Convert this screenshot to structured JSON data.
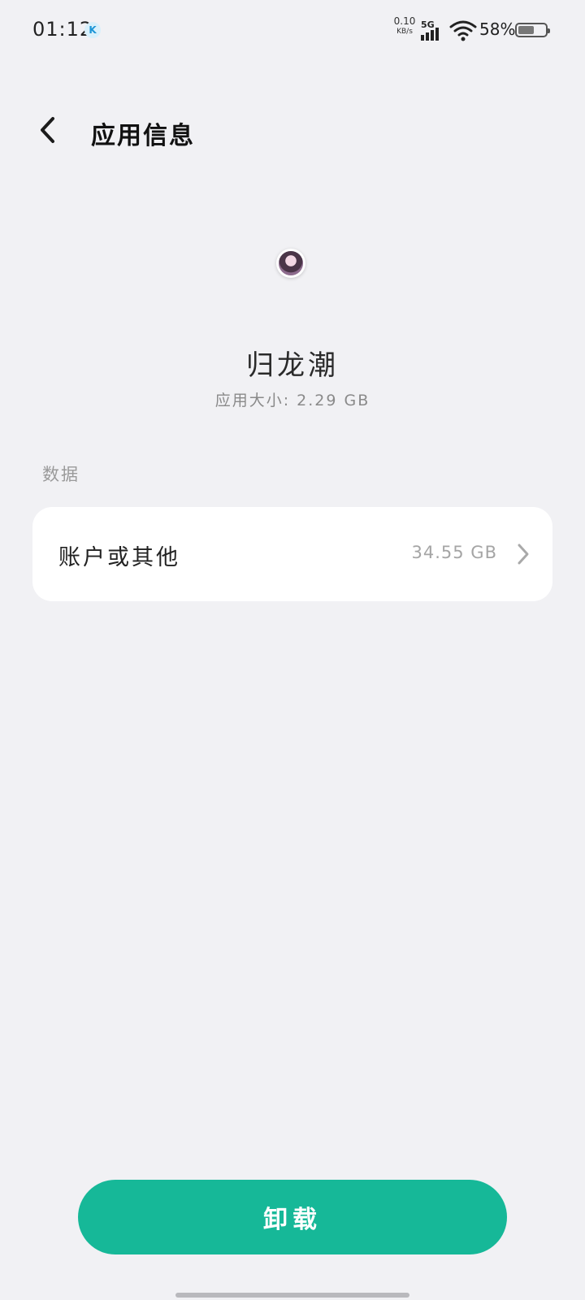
{
  "status_bar": {
    "time": "01:12",
    "app_badge": "K",
    "net_speed_value": "0.10",
    "net_speed_unit": "KB/s",
    "network_type": "5G",
    "battery_percent": "58%",
    "battery_level": 0.58
  },
  "header": {
    "title": "应用信息",
    "back_icon": "chevron-left-icon"
  },
  "app": {
    "name": "归龙潮",
    "size_label": "应用大小: 2.29 GB"
  },
  "data_section": {
    "label": "数据",
    "item_label": "账户或其他",
    "item_value": "34.55 GB",
    "item_icon": "chevron-right-icon"
  },
  "actions": {
    "uninstall_label": "卸载"
  },
  "colors": {
    "background": "#f1f1f4",
    "card": "#ffffff",
    "accent": "#16b898"
  }
}
